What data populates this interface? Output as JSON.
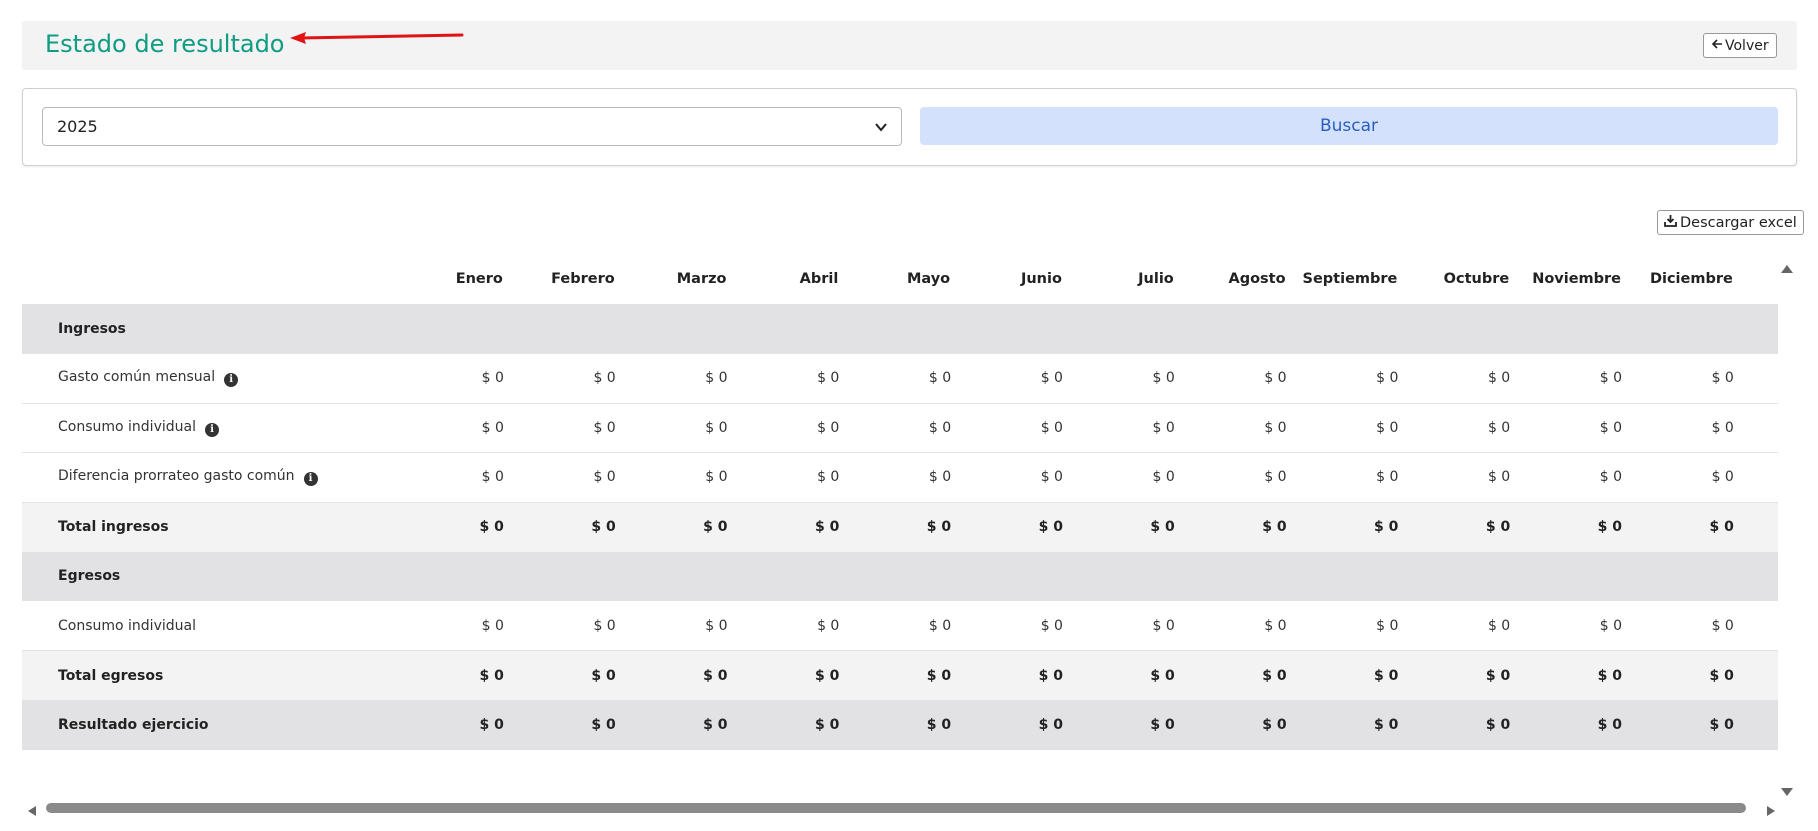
{
  "header": {
    "title": "Estado de resultado",
    "back_label": "Volver"
  },
  "filter": {
    "year_value": "2025",
    "search_label": "Buscar"
  },
  "toolbar": {
    "excel_label": "Descargar excel"
  },
  "table": {
    "months": [
      "Enero",
      "Febrero",
      "Marzo",
      "Abril",
      "Mayo",
      "Junio",
      "Julio",
      "Agosto",
      "Septiembre",
      "Octubre",
      "Noviembre",
      "Diciembre"
    ],
    "rows": [
      {
        "type": "section",
        "label": "Ingresos"
      },
      {
        "type": "item",
        "label": "Gasto común mensual",
        "info": true,
        "values": [
          "$ 0",
          "$ 0",
          "$ 0",
          "$ 0",
          "$ 0",
          "$ 0",
          "$ 0",
          "$ 0",
          "$ 0",
          "$ 0",
          "$ 0",
          "$ 0"
        ]
      },
      {
        "type": "item",
        "label": "Consumo individual",
        "info": true,
        "values": [
          "$ 0",
          "$ 0",
          "$ 0",
          "$ 0",
          "$ 0",
          "$ 0",
          "$ 0",
          "$ 0",
          "$ 0",
          "$ 0",
          "$ 0",
          "$ 0"
        ]
      },
      {
        "type": "item",
        "label": "Diferencia prorrateo gasto común",
        "info": true,
        "values": [
          "$ 0",
          "$ 0",
          "$ 0",
          "$ 0",
          "$ 0",
          "$ 0",
          "$ 0",
          "$ 0",
          "$ 0",
          "$ 0",
          "$ 0",
          "$ 0"
        ]
      },
      {
        "type": "total",
        "label": "Total ingresos",
        "values": [
          "$ 0",
          "$ 0",
          "$ 0",
          "$ 0",
          "$ 0",
          "$ 0",
          "$ 0",
          "$ 0",
          "$ 0",
          "$ 0",
          "$ 0",
          "$ 0"
        ]
      },
      {
        "type": "section",
        "label": "Egresos"
      },
      {
        "type": "item",
        "label": "Consumo individual",
        "info": false,
        "values": [
          "$ 0",
          "$ 0",
          "$ 0",
          "$ 0",
          "$ 0",
          "$ 0",
          "$ 0",
          "$ 0",
          "$ 0",
          "$ 0",
          "$ 0",
          "$ 0"
        ]
      },
      {
        "type": "total",
        "label": "Total egresos",
        "values": [
          "$ 0",
          "$ 0",
          "$ 0",
          "$ 0",
          "$ 0",
          "$ 0",
          "$ 0",
          "$ 0",
          "$ 0",
          "$ 0",
          "$ 0",
          "$ 0"
        ]
      },
      {
        "type": "result",
        "label": "Resultado ejercicio",
        "values": [
          "$ 0",
          "$ 0",
          "$ 0",
          "$ 0",
          "$ 0",
          "$ 0",
          "$ 0",
          "$ 0",
          "$ 0",
          "$ 0",
          "$ 0",
          "$ 0"
        ]
      }
    ]
  },
  "colors": {
    "title": "#0e9c82",
    "search_bg": "#d4e1fd",
    "search_text": "#2a5fbd",
    "annotation_arrow": "#e01414"
  },
  "icons": {
    "back": "arrow-left-icon",
    "dropdown": "chevron-down-icon",
    "download": "download-icon",
    "info": "info-icon"
  }
}
